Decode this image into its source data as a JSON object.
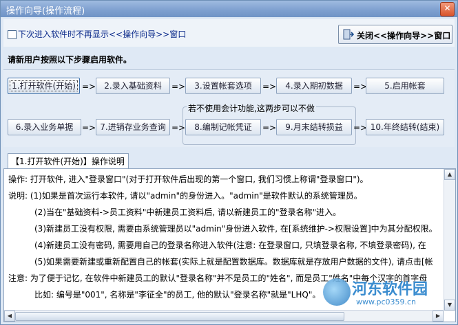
{
  "window": {
    "title": "操作向导(操作流程)",
    "close_label": "✕"
  },
  "topbar": {
    "checkbox_label": "下次进入软件时不再显示<<操作向导>>窗口",
    "close_wizard_label": "关闭<<操作向导>>窗口"
  },
  "heading": "请新用户按照以下步骤启用软件。",
  "steps": [
    "1.打开软件(开始)",
    "2.录入基础资料",
    "3.设置帐套选项",
    "4.录入期初数据",
    "5.启用帐套",
    "6.录入业务单据",
    "7.进销存业务查询",
    "8.编制记帐凭证",
    "9.月末结转损益",
    "10.年终结转(结束)"
  ],
  "arrow": "=>",
  "group_label": "若不使用会计功能,这两步可以不做",
  "tab_label": "【1.打开软件(开始)】操作说明",
  "content_lines": [
    "操作: 打开软件, 进入\"登录窗口\"(对于打开软件后出现的第一个窗口, 我们习惯上称谓\"登录窗口\")。",
    "说明: (1)如果是首次运行本软件, 请以\"admin\"的身份进入。\"admin\"是软件默认的系统管理员。",
    "(2)当在\"基础资料->员工资料\"中新建员工资料后, 请以新建员工的\"登录名称\"进入。",
    "(3)新建员工没有权限, 需要由系统管理员以\"admin\"身份进入软件, 在[系统维护->权限设置]中为其分配权限。",
    "(4)新建员工没有密码, 需要用自己的登录名称进入软件(注意: 在登录窗口, 只填登录名称, 不填登录密码), 在",
    "(5)如果需要新建或重新配置自己的帐套(实际上就是配置数据库。数据库就是存放用户数据的文件), 请点击[帐",
    "注意: 为了便于记忆, 在软件中新建员工的默认\"登录名称\"并不是员工的\"姓名\", 而是员工\"姓名\"中每个汉字的首字母",
    "比如: 编号是\"001\", 名称是\"李征全\"的员工, 他的默认\"登录名称\"就是\"LHQ\"。"
  ],
  "watermark": {
    "text": "河东软件园",
    "url": "www.pc0359.cn"
  }
}
